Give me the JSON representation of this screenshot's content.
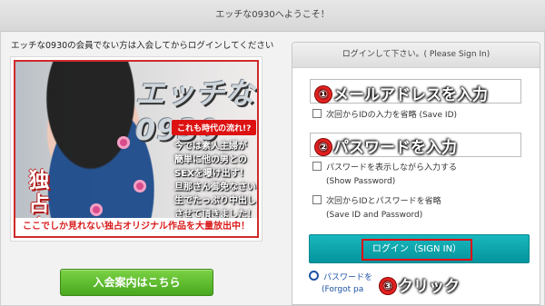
{
  "header": {
    "title": "エッチな0930へようこそ！"
  },
  "left": {
    "notice": "エッチな0930の会員でない方は入会してからログインしてください",
    "banner": {
      "logo": "エッチな0930",
      "catch": "これも時代の流れ!?",
      "copy_lines": [
        "今では素人主婦が",
        "簡単に他の男との",
        "SEXを曝け出す！",
        "旦那さん御免なさい",
        "生でたっぷり中出し",
        "させて頂きました！"
      ],
      "exclusive": "独占人妻",
      "ribbon": "ここでしか見れない独占オリジナル作品を大量放出中！"
    },
    "join_button": "入会案内はこちら"
  },
  "login": {
    "header": "ログインして下さい。( Please Sign In)",
    "email_field_value": "",
    "password_field_value": "",
    "steps": {
      "one": {
        "num": "①",
        "text": "メールアドレスを入力"
      },
      "two": {
        "num": "②",
        "text": "パスワードを入力"
      },
      "three": {
        "num": "③",
        "text": "クリック"
      }
    },
    "remember_id": "次回からIDの入力を省略 (Save ID)",
    "show_password_line1": "パスワードを表示しながら入力する",
    "show_password_line2": "(Show Password)",
    "save_both_line1": "次回からIDとパスワードを省略",
    "save_both_line2": "(Save ID and Password)",
    "signin_button": "ログイン（SIGN IN）",
    "forgot_line1": "パスワードを",
    "forgot_line2": "(Forgot pa"
  },
  "colors": {
    "accent": "#ea1d2c",
    "teal": "#0aa4ab",
    "join_green": "#58b928",
    "link_blue": "#1f53a5"
  }
}
